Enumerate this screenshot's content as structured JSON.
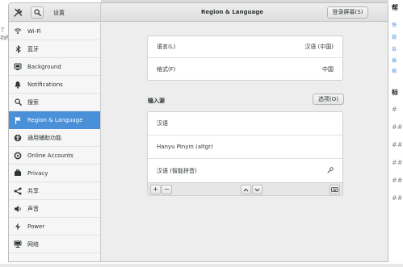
{
  "background": {
    "left_lines": [
      "了",
      "功的"
    ],
    "right_lines": [
      {
        "text": "帮",
        "kind": "head"
      },
      {
        "text": "快",
        "kind": "link"
      },
      {
        "text": "链",
        "kind": "link"
      },
      {
        "text": "自",
        "kind": "link"
      },
      {
        "text": "插",
        "kind": "link"
      },
      {
        "text": "插",
        "kind": "link"
      },
      {
        "text": "标",
        "kind": "head"
      },
      {
        "text": "#",
        "kind": "hash"
      },
      {
        "text": "##",
        "kind": "hash"
      },
      {
        "text": "##",
        "kind": "hash"
      },
      {
        "text": "##",
        "kind": "hash"
      },
      {
        "text": "##",
        "kind": "hash"
      },
      {
        "text": "##",
        "kind": "hash"
      }
    ]
  },
  "headerbar": {
    "settings_title": "设置",
    "title": "Region & Language",
    "login_screen_button": "登录屏幕(S)"
  },
  "sidebar": {
    "items": [
      {
        "label": "Wi-Fi",
        "icon": "wifi-icon",
        "active": false
      },
      {
        "label": "蓝牙",
        "icon": "bluetooth-icon",
        "active": false
      },
      {
        "label": "Background",
        "icon": "background-icon",
        "active": false
      },
      {
        "label": "Notifications",
        "icon": "notifications-icon",
        "active": false
      },
      {
        "label": "搜索",
        "icon": "search-icon",
        "active": false
      },
      {
        "label": "Region & Language",
        "icon": "flag-icon",
        "active": true
      },
      {
        "label": "通用辅助功能",
        "icon": "accessibility-icon",
        "active": false
      },
      {
        "label": "Online Accounts",
        "icon": "online-accounts-icon",
        "active": false
      },
      {
        "label": "Privacy",
        "icon": "privacy-icon",
        "active": false
      },
      {
        "label": "共享",
        "icon": "share-icon",
        "active": false
      },
      {
        "label": "声音",
        "icon": "sound-icon",
        "active": false
      },
      {
        "label": "Power",
        "icon": "power-icon",
        "active": false
      },
      {
        "label": "网络",
        "icon": "network-icon",
        "active": false
      }
    ]
  },
  "region": {
    "language_label": "语言(L)",
    "language_value": "汉语 (中国)",
    "formats_label": "格式(F)",
    "formats_value": "中国"
  },
  "input_sources": {
    "section_label": "输入源",
    "options_button": "选项(O)",
    "items": [
      {
        "label": "汉语",
        "has_settings": false
      },
      {
        "label": "Hanyu Pinyin (altgr)",
        "has_settings": false
      },
      {
        "label": "汉语 (智能拼音)",
        "has_settings": true
      }
    ],
    "toolbar": {
      "add": "+",
      "remove": "−"
    }
  }
}
